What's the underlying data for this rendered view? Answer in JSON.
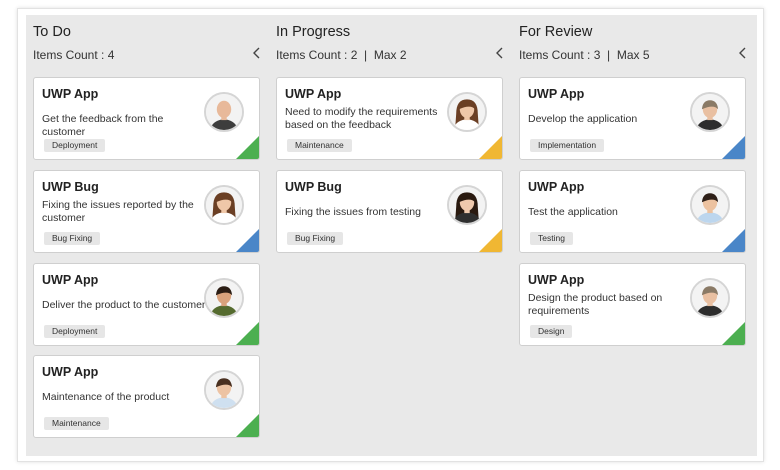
{
  "colors": {
    "green": "#4caf50",
    "blue": "#4a86c8",
    "yellow": "#f0b733"
  },
  "columns": [
    {
      "title": "To Do",
      "count_text": "Items Count : 4",
      "cards": [
        {
          "title": "UWP App",
          "desc": "Get the feedback from the customer",
          "tag": "Deployment",
          "color": "green",
          "avatar": "bald-man"
        },
        {
          "title": "UWP Bug",
          "desc": "Fixing the issues reported by the customer",
          "tag": "Bug Fixing",
          "color": "blue",
          "avatar": "woman-long-hair"
        },
        {
          "title": "UWP App",
          "desc": "Deliver the product to the customer",
          "tag": "Deployment",
          "color": "green",
          "avatar": "man-dark-hair"
        },
        {
          "title": "UWP App",
          "desc": "Maintenance of the product",
          "tag": "Maintenance",
          "color": "green",
          "avatar": "man-short-hair"
        }
      ]
    },
    {
      "title": "In Progress",
      "count_text": "Items Count : 2  |  Max 2",
      "cards": [
        {
          "title": "UWP App",
          "desc": "Need to modify the requirements based on the feedback",
          "tag": "Maintenance",
          "color": "yellow",
          "avatar": "woman-long-hair"
        },
        {
          "title": "UWP Bug",
          "desc": "Fixing the issues from testing",
          "tag": "Bug Fixing",
          "color": "yellow",
          "avatar": "woman-suit"
        }
      ]
    },
    {
      "title": "For Review",
      "count_text": "Items Count : 3  |  Max 5",
      "cards": [
        {
          "title": "UWP App",
          "desc": "Develop the application",
          "tag": "Implementation",
          "color": "blue",
          "avatar": "older-woman"
        },
        {
          "title": "UWP App",
          "desc": "Test the application",
          "tag": "Testing",
          "color": "blue",
          "avatar": "man-shirt"
        },
        {
          "title": "UWP App",
          "desc": "Design the product based on requirements",
          "tag": "Design",
          "color": "green",
          "avatar": "older-woman"
        }
      ]
    }
  ]
}
